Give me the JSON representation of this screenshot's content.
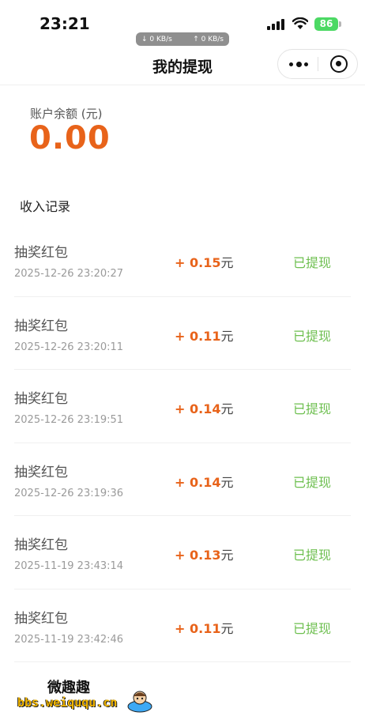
{
  "status_bar": {
    "time": "23:21",
    "download_speed": "↓ 0 KB/s",
    "upload_speed": "↑ 0 KB/s",
    "battery": "86"
  },
  "nav": {
    "title": "我的提现",
    "more_icon": "more-dots-icon",
    "close_icon": "target-close-icon"
  },
  "balance": {
    "label": "账户余额 (元)",
    "amount": "0.00",
    "color": "#e8631a"
  },
  "records_title": "收入记录",
  "records": [
    {
      "name": "抽奖红包",
      "time": "2025-12-26 23:20:27",
      "amount": "+ 0.15",
      "unit": "元",
      "status": "已提现"
    },
    {
      "name": "抽奖红包",
      "time": "2025-12-26 23:20:11",
      "amount": "+ 0.11",
      "unit": "元",
      "status": "已提现"
    },
    {
      "name": "抽奖红包",
      "time": "2025-12-26 23:19:51",
      "amount": "+ 0.14",
      "unit": "元",
      "status": "已提现"
    },
    {
      "name": "抽奖红包",
      "time": "2025-12-26 23:19:36",
      "amount": "+ 0.14",
      "unit": "元",
      "status": "已提现"
    },
    {
      "name": "抽奖红包",
      "time": "2025-11-19 23:43:14",
      "amount": "+ 0.13",
      "unit": "元",
      "status": "已提现"
    },
    {
      "name": "抽奖红包",
      "time": "2025-11-19 23:42:46",
      "amount": "+ 0.11",
      "unit": "元",
      "status": "已提现"
    }
  ],
  "status_color": "#6dbf4f",
  "watermark": {
    "title": "微趣趣",
    "url": "bbs.weiququ.cn"
  }
}
